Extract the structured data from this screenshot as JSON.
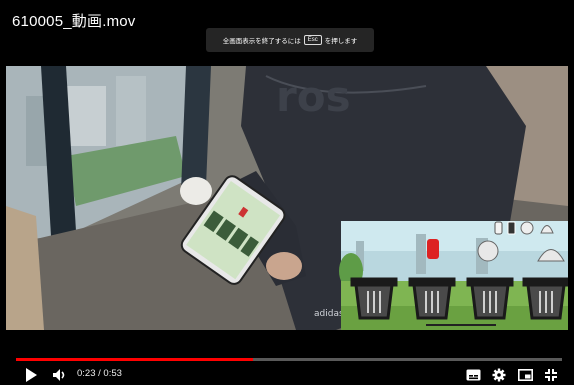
{
  "window": {
    "title": "610005_動画.mov"
  },
  "fullscreen_hint": {
    "before": "全画面表示を終了するには",
    "key": "Esc",
    "after": "を押します"
  },
  "player": {
    "current_time": "0:23",
    "separator": "/",
    "duration": "0:53",
    "progress": 0.434,
    "progress_color": "#ff0000"
  },
  "video": {
    "shirt_text": "adidas",
    "game_overlay": {
      "bins": 4,
      "items": [
        "bottle-icon",
        "can-icon",
        "paper-ball-icon",
        "bag-icon"
      ]
    }
  },
  "controls": {
    "play_icon": "play-icon",
    "volume_icon": "volume-icon",
    "subtitles_icon": "subtitles-icon",
    "settings_icon": "gear-icon",
    "miniplayer_icon": "miniplayer-icon",
    "exit_fullscreen_icon": "exit-fullscreen-icon"
  }
}
